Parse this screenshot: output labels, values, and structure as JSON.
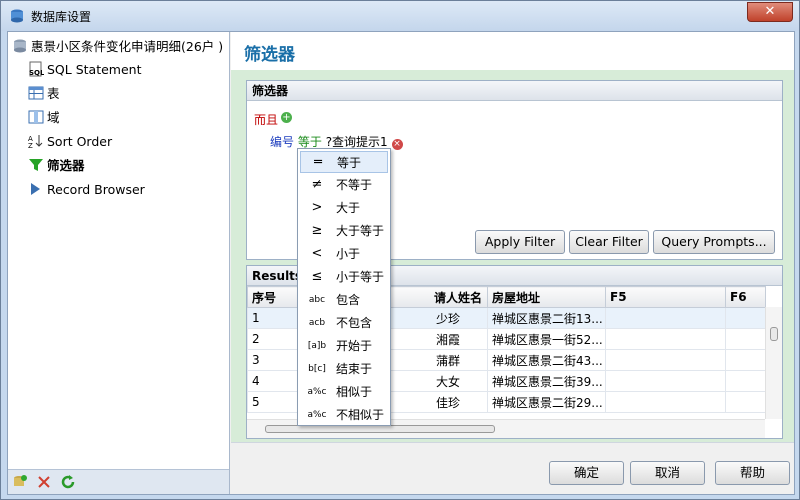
{
  "window": {
    "title": "数据库设置",
    "close_label": "✕"
  },
  "tree": {
    "root": "惠景小区条件变化申请明细(26户 )",
    "items": [
      {
        "label": "SQL Statement",
        "icon": "sql-icon"
      },
      {
        "label": "表",
        "icon": "table-icon"
      },
      {
        "label": "域",
        "icon": "field-icon"
      },
      {
        "label": "Sort Order",
        "icon": "sort-az-icon"
      },
      {
        "label": "筛选器",
        "icon": "funnel-icon"
      },
      {
        "label": "Record Browser",
        "icon": "record-browser-icon"
      }
    ]
  },
  "header": {
    "title": "筛选器"
  },
  "filter_panel": {
    "title": "筛选器",
    "and_label": "而且",
    "field": "编号",
    "operator": "等于",
    "value": "?查询提示1",
    "apply": "Apply Filter",
    "clear": "Clear Filter",
    "prompts": "Query Prompts..."
  },
  "results": {
    "title": "Results",
    "columns": [
      "序号",
      "请人姓名",
      "房屋地址",
      "F5",
      "F6"
    ],
    "rows": [
      [
        "1",
        "少珍",
        "禅城区惠景二街13..."
      ],
      [
        "2",
        "湘霞",
        "禅城区惠景一街52..."
      ],
      [
        "3",
        "蒲群",
        "禅城区惠景二街43..."
      ],
      [
        "4",
        "大女",
        "禅城区惠景二街39..."
      ],
      [
        "5",
        "佳珍",
        "禅城区惠景二街29..."
      ]
    ]
  },
  "menu": [
    {
      "sym": "═",
      "label": "等于"
    },
    {
      "sym": "≠",
      "label": "不等于"
    },
    {
      "sym": ">",
      "label": "大于"
    },
    {
      "sym": "≥",
      "label": "大于等于"
    },
    {
      "sym": "<",
      "label": "小于"
    },
    {
      "sym": "≤",
      "label": "小于等于"
    },
    {
      "sym": "abc",
      "label": "包含"
    },
    {
      "sym": "acb",
      "label": "不包含"
    },
    {
      "sym": "[a]b",
      "label": "开始于"
    },
    {
      "sym": "b[c]",
      "label": "结束于"
    },
    {
      "sym": "a%c",
      "label": "相似于"
    },
    {
      "sym": "a%c",
      "label": "不相似于"
    }
  ],
  "buttons": {
    "ok": "确定",
    "cancel": "取消",
    "help": "帮助"
  }
}
